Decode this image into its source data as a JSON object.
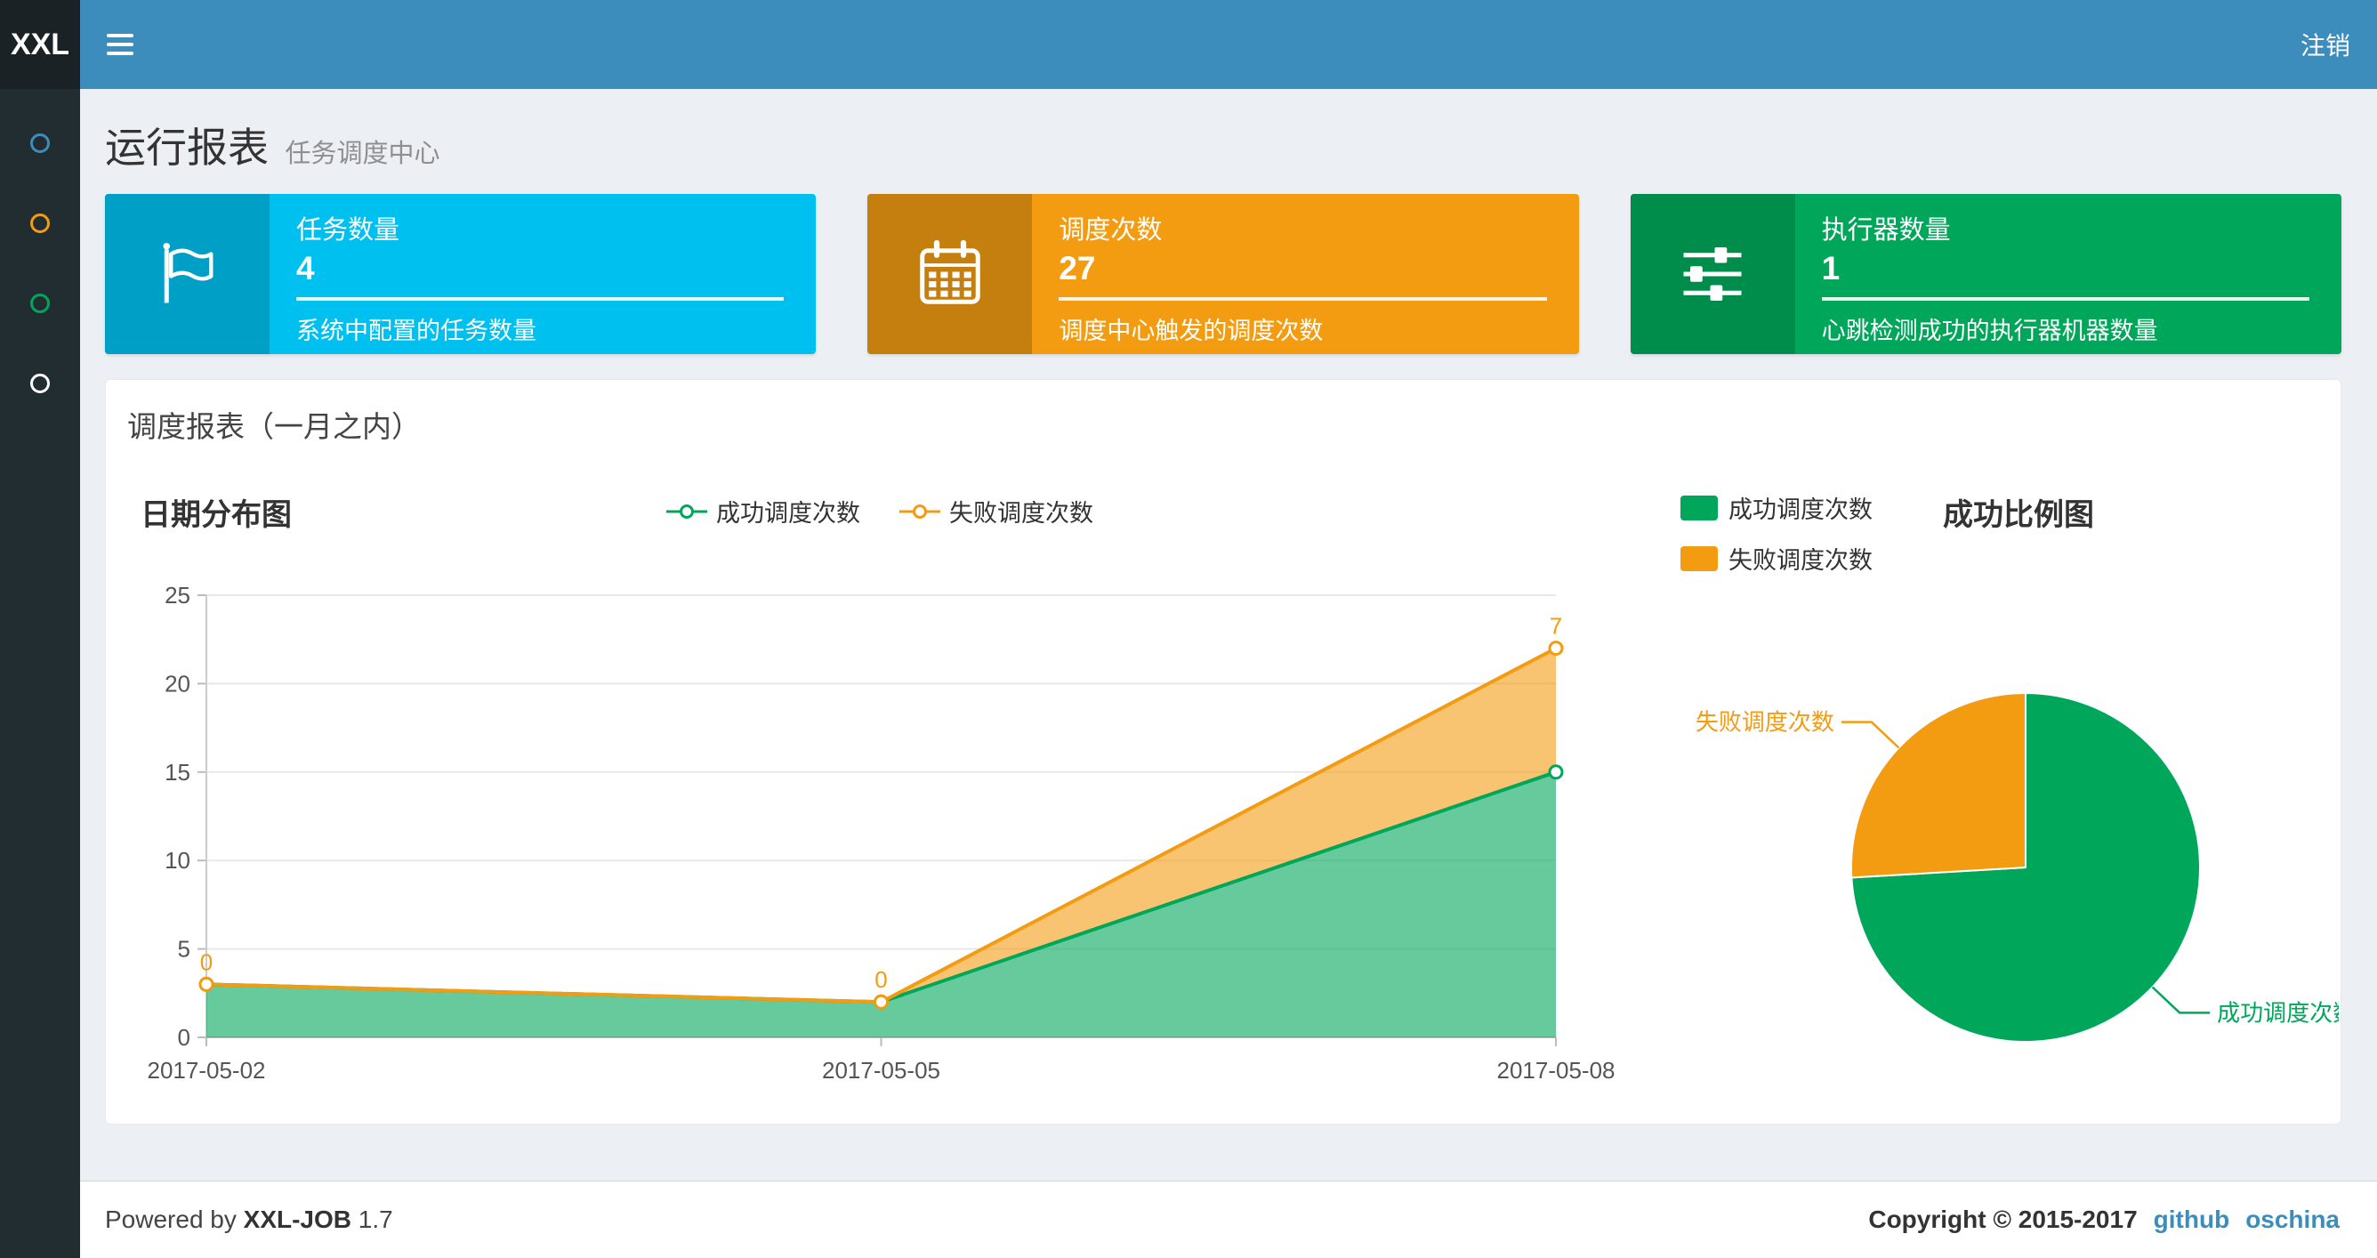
{
  "navbar": {
    "logo": "XXL",
    "logout": "注销",
    "bg_color": "#3c8dbc",
    "logo_bg_color": "#1a2226"
  },
  "sidebar": {
    "bg_color": "#222d32",
    "items": [
      {
        "name": "menu-1",
        "color": "#3c8dbc"
      },
      {
        "name": "menu-2",
        "color": "#f39c12"
      },
      {
        "name": "menu-3",
        "color": "#00a65a"
      },
      {
        "name": "menu-4",
        "color": "#ffffff"
      }
    ]
  },
  "page_header": {
    "title": "运行报表",
    "subtitle": "任务调度中心"
  },
  "info_boxes": [
    {
      "title": "任务数量",
      "value": "4",
      "desc": "系统中配置的任务数量",
      "color": "#00c0ef",
      "icon_color": "#009fc6",
      "icon": "flag-icon"
    },
    {
      "title": "调度次数",
      "value": "27",
      "desc": "调度中心触发的调度次数",
      "color": "#f39c12",
      "icon_color": "#c47f0e",
      "icon": "calendar-icon"
    },
    {
      "title": "执行器数量",
      "value": "1",
      "desc": "心跳检测成功的执行器机器数量",
      "color": "#00a65a",
      "icon_color": "#008d4c",
      "icon": "sliders-icon"
    }
  ],
  "panel": {
    "title": "调度报表（一月之内）"
  },
  "chart_data": [
    {
      "type": "area",
      "title": "日期分布图",
      "stacked": true,
      "x": [
        "2017-05-02",
        "2017-05-05",
        "2017-05-08"
      ],
      "series": [
        {
          "name": "成功调度次数",
          "color": "#00a65a",
          "values": [
            3,
            2,
            15
          ]
        },
        {
          "name": "失败调度次数",
          "color": "#f39c12",
          "values": [
            0,
            0,
            7
          ]
        }
      ],
      "point_labels": {
        "series": "失败调度次数",
        "values": [
          "0",
          "0",
          "7"
        ]
      },
      "ylim": [
        0,
        25
      ],
      "yticks": [
        0,
        5,
        10,
        15,
        20,
        25
      ],
      "legend_position": "top-center",
      "grid": true
    },
    {
      "type": "pie",
      "title": "成功比例图",
      "labels": [
        "成功调度次数",
        "失败调度次数"
      ],
      "values": [
        20,
        7
      ],
      "colors": [
        "#00a65a",
        "#f39c12"
      ],
      "legend_position": "top-left",
      "start_angle": 90
    }
  ],
  "footer": {
    "powered_by": "Powered by",
    "brand": "XXL-JOB",
    "version": "1.7",
    "copyright": "Copyright © 2015-2017",
    "links": [
      "github",
      "oschina"
    ]
  }
}
